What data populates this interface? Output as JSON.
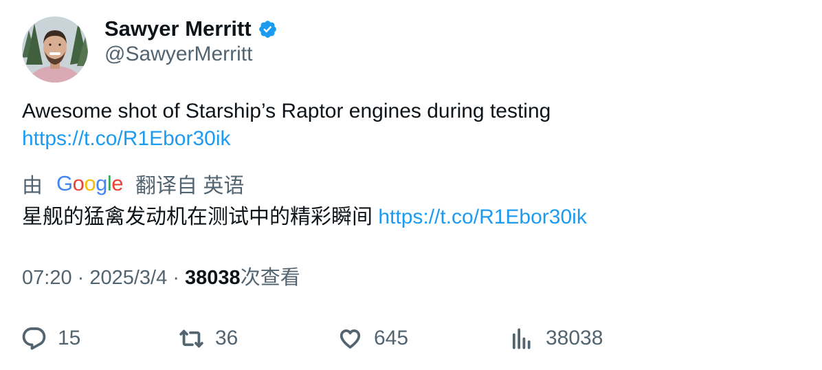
{
  "author": {
    "name": "Sawyer Merritt",
    "handle": "@SawyerMerritt",
    "verified": true
  },
  "tweet": {
    "text": "Awesome shot of Starship’s Raptor engines during testing",
    "link": "https://t.co/R1Ebor30ik"
  },
  "translation": {
    "by_label": "由",
    "provider": "Google",
    "from_label": "翻译自 英语",
    "text": "星舰的猛禽发动机在测试中的精彩瞬间",
    "link": "https://t.co/R1Ebor30ik"
  },
  "meta": {
    "time": "07:20",
    "separator": "·",
    "date": "2025/3/4",
    "views_count": "38038",
    "views_label": "次查看"
  },
  "actions": {
    "replies": "15",
    "retweets": "36",
    "likes": "645",
    "views": "38038"
  },
  "colors": {
    "link": "#1d9bf0",
    "secondary_text": "#536471",
    "primary_text": "#0f1419",
    "verified": "#1d9bf0"
  },
  "icons": [
    "verified-badge-icon",
    "reply-icon",
    "retweet-icon",
    "like-icon",
    "views-icon"
  ]
}
